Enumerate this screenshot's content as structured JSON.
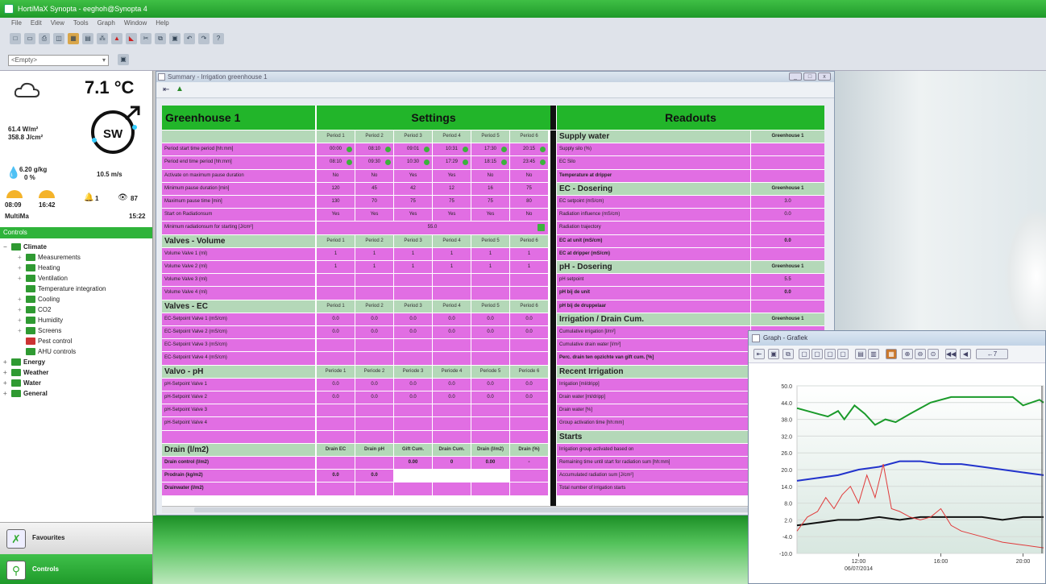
{
  "app": {
    "title": "HortiMaX Synopta - eeghoh@Synopta 4"
  },
  "menu": [
    "File",
    "Edit",
    "View",
    "Tools",
    "Graph",
    "Window",
    "Help"
  ],
  "toolbar": {
    "empty_combo": "<Empty>"
  },
  "weather": {
    "temperature": "7.1 °C",
    "radiation": "61.4 W/m²",
    "radiation_sum": "358.8 J/cm²",
    "humidity": "6.20 g/kg",
    "humidity_pct": "0 %",
    "wind_speed": "10.5 m/s",
    "wind_dir": "SW",
    "sunrise": "08:09",
    "sunset": "16:42",
    "alarm_count": "1",
    "eye_count": "87",
    "location": "MultiMa",
    "time": "15:22"
  },
  "sidebar": {
    "controls_header": "Controls",
    "tree": [
      {
        "label": "Climate",
        "level": 0,
        "bold": true,
        "exp": "−"
      },
      {
        "label": "Measurements",
        "level": 1,
        "bold": false,
        "exp": "+"
      },
      {
        "label": "Heating",
        "level": 1,
        "bold": false,
        "exp": "+"
      },
      {
        "label": "Ventilation",
        "level": 1,
        "bold": false,
        "exp": "+"
      },
      {
        "label": "Temperature integration",
        "level": 1,
        "bold": false,
        "exp": ""
      },
      {
        "label": "Cooling",
        "level": 1,
        "bold": false,
        "exp": "+"
      },
      {
        "label": "CO2",
        "level": 1,
        "bold": false,
        "exp": "+"
      },
      {
        "label": "Humidity",
        "level": 1,
        "bold": false,
        "exp": "+"
      },
      {
        "label": "Screens",
        "level": 1,
        "bold": false,
        "exp": "+"
      },
      {
        "label": "Pest control",
        "level": 1,
        "bold": false,
        "exp": ""
      },
      {
        "label": "AHU controls",
        "level": 1,
        "bold": false,
        "exp": ""
      },
      {
        "label": "Energy",
        "level": 0,
        "bold": true,
        "exp": "+"
      },
      {
        "label": "Weather",
        "level": 0,
        "bold": true,
        "exp": "+"
      },
      {
        "label": "Water",
        "level": 0,
        "bold": true,
        "exp": "+"
      },
      {
        "label": "General",
        "level": 0,
        "bold": true,
        "exp": "+"
      }
    ],
    "favourites": "Favourites",
    "controls": "Controls"
  },
  "summary": {
    "window_title": "Summary - Irrigation greenhouse 1",
    "title_left": "Greenhouse 1",
    "title_settings": "Settings",
    "title_readouts": "Readouts",
    "period_headers": [
      "Period 1",
      "Period 2",
      "Period 3",
      "Period 4",
      "Period 5",
      "Period 6"
    ],
    "periode_headers": [
      "Periode 1",
      "Periode 2",
      "Periode 3",
      "Periode 4",
      "Periode 5",
      "Periode 6"
    ],
    "drain_headers": [
      "Drain EC",
      "Drain pH",
      "Gift Cum.",
      "Drain Cum.",
      "Drain (l/m2)",
      "Drain (%)"
    ],
    "left_rows": [
      {
        "label": "Period start time period [hh:mm]",
        "values": [
          "00:00",
          "08:10",
          "09:01",
          "10:31",
          "17:30",
          "20:15"
        ],
        "style": "pink"
      },
      {
        "label": "Period end time period [hh:mm]",
        "values": [
          "08:10",
          "09:30",
          "10:30",
          "17:29",
          "18:15",
          "23:45"
        ],
        "style": "pink"
      },
      {
        "label": "Activate on maximum pause duration",
        "values": [
          "No",
          "No",
          "Yes",
          "Yes",
          "No",
          "No"
        ],
        "style": "pink"
      },
      {
        "label": "Minimum pause duration [min]",
        "values": [
          "120",
          "45",
          "42",
          "12",
          "16",
          "75"
        ],
        "style": "pink"
      },
      {
        "label": "Maximum pause time [min]",
        "values": [
          "130",
          "70",
          "75",
          "75",
          "75",
          "80"
        ],
        "style": "pink"
      },
      {
        "label": "Start on Radiationsum",
        "values": [
          "Yes",
          "Yes",
          "Yes",
          "Yes",
          "Yes",
          "No"
        ],
        "style": "pink"
      },
      {
        "label": "Minimum radiationsum for starting [J/cm²]",
        "values": [
          "",
          "",
          "55.0",
          "",
          "",
          ""
        ],
        "style": "pink"
      },
      {
        "label": "Valves - Volume",
        "values": [],
        "style": "section",
        "hdr": "period"
      },
      {
        "label": "Volume Valve 1 (ml)",
        "values": [
          "1",
          "1",
          "1",
          "1",
          "1",
          "1"
        ],
        "style": "pink"
      },
      {
        "label": "Volume Valve 2 (ml)",
        "values": [
          "1",
          "1",
          "1",
          "1",
          "1",
          "1"
        ],
        "style": "pink"
      },
      {
        "label": "Volume Valve 3 (ml)",
        "values": [
          "",
          "",
          "",
          "",
          "",
          ""
        ],
        "style": "pink"
      },
      {
        "label": "Volume Valve 4 (ml)",
        "values": [
          "",
          "",
          "",
          "",
          "",
          ""
        ],
        "style": "pink"
      },
      {
        "label": "Valves - EC",
        "values": [],
        "style": "section",
        "hdr": "period"
      },
      {
        "label": "EC-Setpoint Valve 1 (mS/cm)",
        "values": [
          "0.0",
          "0.0",
          "0.0",
          "0.0",
          "0.0",
          "0.0"
        ],
        "style": "pink"
      },
      {
        "label": "EC-Setpoint Valve 2 (mS/cm)",
        "values": [
          "0.0",
          "0.0",
          "0.0",
          "0.0",
          "0.0",
          "0.0"
        ],
        "style": "pink"
      },
      {
        "label": "EC-Setpoint Valve 3 (mS/cm)",
        "values": [
          "",
          "",
          "",
          "",
          "",
          ""
        ],
        "style": "pink"
      },
      {
        "label": "EC-Setpoint Valve 4 (mS/cm)",
        "values": [
          "",
          "",
          "",
          "",
          "",
          ""
        ],
        "style": "pink"
      },
      {
        "label": "Valvo - pH",
        "values": [],
        "style": "section",
        "hdr": "periode"
      },
      {
        "label": "pH-Setpoint Valve 1",
        "values": [
          "0.0",
          "0.0",
          "0.0",
          "0.0",
          "0.0",
          "0.0"
        ],
        "style": "pink"
      },
      {
        "label": "pH-Setpoint Valve 2",
        "values": [
          "0.0",
          "0.0",
          "0.0",
          "0.0",
          "0.0",
          "0.0"
        ],
        "style": "pink"
      },
      {
        "label": "pH-Setpoint Valve 3",
        "values": [
          "",
          "",
          "",
          "",
          "",
          ""
        ],
        "style": "pink"
      },
      {
        "label": "pH-Setpoint Valve 4",
        "values": [
          "",
          "",
          "",
          "",
          "",
          ""
        ],
        "style": "pink"
      },
      {
        "label": "",
        "values": [
          "",
          "",
          "",
          "",
          "",
          ""
        ],
        "style": "pink"
      },
      {
        "label": "Drain (l/m2)",
        "values": [],
        "style": "section",
        "hdr": "drain"
      },
      {
        "label": "Drain control (l/m2)",
        "values": [
          "",
          "",
          "0.00",
          "0",
          "0.00",
          "-"
        ],
        "style": "pinkbold"
      },
      {
        "label": "Prodrain (kg/m2)",
        "values": [
          "0.0",
          "0.0",
          "",
          "",
          "",
          ""
        ],
        "style": "pinkbold"
      },
      {
        "label": "Drainwater (l/m2)",
        "values": [
          "",
          "",
          "",
          "",
          "",
          ""
        ],
        "style": "pinkbold"
      }
    ],
    "right_rows": [
      {
        "label": "Supply water",
        "value": "Greenhouse 1",
        "style": "section"
      },
      {
        "label": "Supply silo (%)",
        "value": "",
        "style": "pink"
      },
      {
        "label": "EC Silo",
        "value": "",
        "style": "pink"
      },
      {
        "label": "Temperature at dripper",
        "value": "",
        "style": "pinkbold"
      },
      {
        "label": "EC - Dosering",
        "value": "Greenhouse 1",
        "style": "section"
      },
      {
        "label": "EC setpoint (mS/cm)",
        "value": "3.0",
        "style": "pink"
      },
      {
        "label": "Radiation influence (mS/cm)",
        "value": "0.0",
        "style": "pink"
      },
      {
        "label": "Radiation trajectory",
        "value": "",
        "style": "pink"
      },
      {
        "label": "EC at unit (mS/cm)",
        "value": "0.0",
        "style": "pinkbold"
      },
      {
        "label": "EC at dripper (mS/cm)",
        "value": "",
        "style": "pinkbold"
      },
      {
        "label": "pH - Dosering",
        "value": "Greenhouse 1",
        "style": "section"
      },
      {
        "label": "pH setpoint",
        "value": "5.5",
        "style": "pink"
      },
      {
        "label": "pH bij de unit",
        "value": "0.0",
        "style": "pinkbold"
      },
      {
        "label": "pH bij de druppelaar",
        "value": "",
        "style": "pinkbold"
      },
      {
        "label": "Irrigation / Drain   Cum.",
        "value": "Greenhouse 1",
        "style": "section"
      },
      {
        "label": "Cumulative irrigation [l/m²]",
        "value": "",
        "style": "pink"
      },
      {
        "label": "Cumulative drain water [l/m²]",
        "value": "",
        "style": "pink"
      },
      {
        "label": "Perc. drain ten opzichte van gift cum. [%]",
        "value": "",
        "style": "pinkbold"
      },
      {
        "label": "Recent Irrigation",
        "value": "",
        "style": "section"
      },
      {
        "label": "Irrigation [ml/dripp]",
        "value": "",
        "style": "pink"
      },
      {
        "label": "Drain water [ml/dripp]",
        "value": "",
        "style": "pink"
      },
      {
        "label": "Drain water [%]",
        "value": "",
        "style": "pink"
      },
      {
        "label": "Group activation time [hh:mm]",
        "value": "",
        "style": "pink"
      },
      {
        "label": "Starts",
        "value": "",
        "style": "section"
      },
      {
        "label": "Irrigation group activated based on",
        "value": "",
        "style": "pink"
      },
      {
        "label": "Remaining time until start for radiation sum [hh:mm]",
        "value": "",
        "style": "pink"
      },
      {
        "label": "Accumulated radiation sum [J/cm²]",
        "value": "",
        "style": "pink"
      },
      {
        "label": "Total number of irrigation starts",
        "value": "",
        "style": "pink"
      }
    ]
  },
  "graph": {
    "window_title": "Graph - Grafiek",
    "chart_data": {
      "type": "line",
      "ylim": [
        -10.0,
        50.0
      ],
      "y_ticks": [
        "50.0",
        "44.0",
        "38.0",
        "32.0",
        "26.0",
        "20.0",
        "14.0",
        "8.0",
        "2.0",
        "-4.0",
        "-10.0"
      ],
      "x_ticks": [
        "12:00",
        "16:00",
        "20:00"
      ],
      "x_date": "06/07/2014",
      "xlim_hours": [
        9.0,
        21.0
      ],
      "series": [
        {
          "color": "#1a9a2a",
          "x": [
            9.0,
            9.5,
            10.0,
            10.5,
            11.0,
            11.3,
            11.8,
            12.3,
            12.8,
            13.3,
            13.8,
            14.5,
            15.5,
            16.5,
            17.5,
            18.5,
            19.5,
            20.0,
            20.8,
            21.0
          ],
          "y": [
            42,
            41,
            40,
            39,
            41,
            38,
            43,
            40,
            36,
            38,
            37,
            40,
            44,
            46,
            46,
            46,
            46,
            43,
            45,
            44
          ]
        },
        {
          "color": "#2233cc",
          "x": [
            9.0,
            10.0,
            11.0,
            12.0,
            13.0,
            14.0,
            15.0,
            16.0,
            17.0,
            18.0,
            19.0,
            20.0,
            21.0
          ],
          "y": [
            16,
            17,
            18,
            20,
            21,
            23,
            23,
            22,
            22,
            21,
            20,
            19,
            18
          ]
        },
        {
          "color": "#111111",
          "x": [
            9.0,
            10.0,
            11.0,
            12.0,
            13.0,
            14.0,
            15.0,
            16.0,
            17.0,
            18.0,
            19.0,
            20.0,
            21.0
          ],
          "y": [
            0,
            1,
            2,
            2,
            3,
            2,
            3,
            3,
            3,
            3,
            2,
            3,
            3
          ]
        },
        {
          "color": "#e03a3a",
          "x": [
            9.0,
            9.5,
            10.0,
            10.4,
            10.8,
            11.2,
            11.6,
            12.0,
            12.4,
            12.8,
            13.2,
            13.6,
            14.0,
            14.5,
            15.0,
            15.5,
            16.0,
            16.5,
            17.0,
            18.0,
            19.0,
            20.0,
            21.0
          ],
          "y": [
            -2,
            3,
            5,
            10,
            6,
            11,
            14,
            8,
            18,
            10,
            22,
            6,
            5,
            3,
            2,
            3,
            6,
            0,
            -2,
            -4,
            -6,
            -7,
            -8
          ]
        }
      ]
    }
  }
}
